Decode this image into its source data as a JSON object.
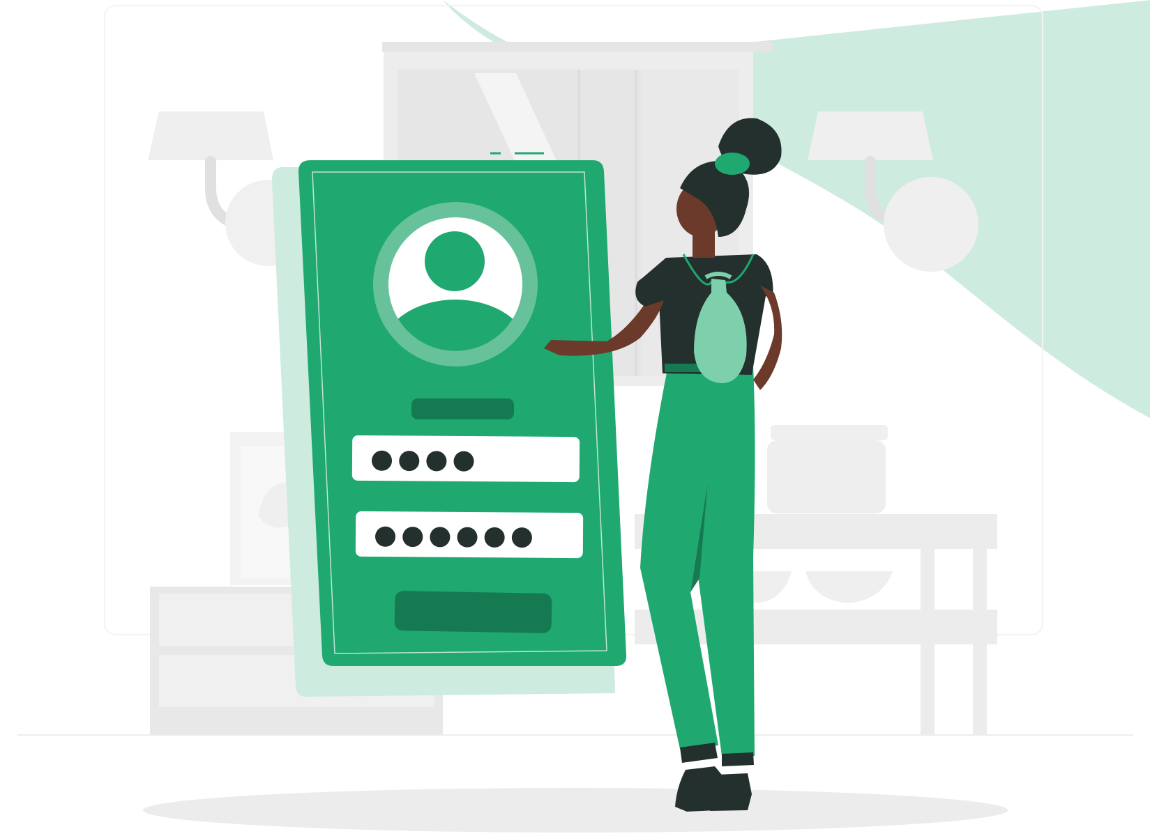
{
  "illustration": {
    "theme": "mobile login",
    "colors": {
      "accent": "#1fa870",
      "accent_dark": "#157a51",
      "accent_light": "#67c29b",
      "background_blob": "#cdebdf",
      "furniture": "#ebebeb",
      "ink": "#24302e",
      "skin": "#6b3a2a"
    }
  },
  "login_card": {
    "avatar_icon": "user-avatar-icon",
    "username_value": "●●●●",
    "password_value": "●●●●●●"
  }
}
